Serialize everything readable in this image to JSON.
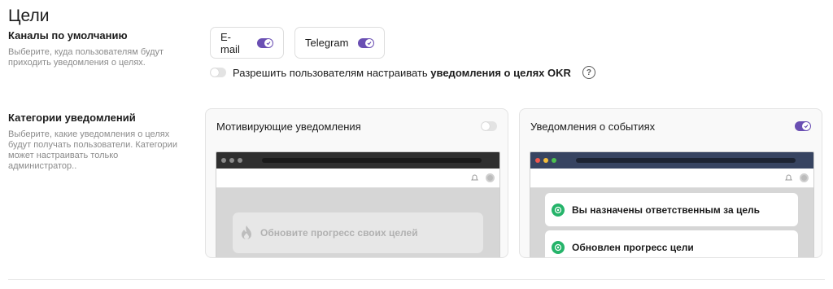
{
  "page": {
    "title": "Цели"
  },
  "default_channels": {
    "title": "Каналы по умолчанию",
    "description_line1": "Выберите, куда пользователям будут",
    "description_line2": "приходить уведомления о целях.",
    "channels": [
      {
        "label": "E-mail",
        "enabled": true
      },
      {
        "label": "Telegram",
        "enabled": true
      }
    ],
    "allow_users": {
      "enabled": false,
      "text": "Разрешить пользователям настраивать ",
      "text_bold": "уведомления о целях OKR",
      "help": "?"
    }
  },
  "categories": {
    "title": "Категории уведомлений",
    "description_lines": [
      "Выберите, какие уведомления о целях",
      "будут получать пользователи. Категории",
      "может настраивать только",
      "администратор.."
    ],
    "cards": [
      {
        "title": "Мотивирующие уведомления",
        "enabled": false,
        "preview_items": [
          "Обновите прогресс своих целей"
        ]
      },
      {
        "title": "Уведомления о событиях",
        "enabled": true,
        "preview_items": [
          "Вы назначены ответственным за цель",
          "Обновлен прогресс цели"
        ]
      }
    ]
  },
  "colors": {
    "accent": "#6a4fb3",
    "success": "#25b46a",
    "muted_text": "#8b8b8b",
    "toggle_off": "#e3e3e3"
  },
  "icons": [
    "check-icon",
    "help-icon",
    "flame-icon",
    "target-icon",
    "bell-icon",
    "avatar"
  ]
}
